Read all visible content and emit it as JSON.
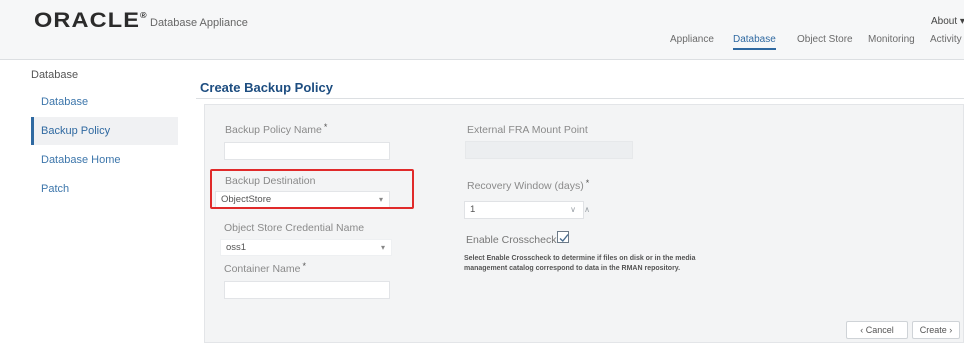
{
  "header": {
    "logo": "ORACLE",
    "product": "Database Appliance",
    "about": "About",
    "tabs": [
      {
        "label": "Appliance",
        "active": false
      },
      {
        "label": "Database",
        "active": true
      },
      {
        "label": "Object Store",
        "active": false
      },
      {
        "label": "Monitoring",
        "active": false
      },
      {
        "label": "Activity",
        "active": false
      }
    ]
  },
  "sidebar": {
    "title": "Database",
    "items": [
      {
        "label": "Database",
        "active": false
      },
      {
        "label": "Backup Policy",
        "active": true
      },
      {
        "label": "Database Home",
        "active": false
      },
      {
        "label": "Patch",
        "active": false
      }
    ]
  },
  "main": {
    "title": "Create Backup Policy",
    "form": {
      "backup_policy_name": {
        "label": "Backup Policy Name",
        "value": ""
      },
      "external_fra": {
        "label": "External FRA Mount Point",
        "value": ""
      },
      "backup_destination": {
        "label": "Backup Destination",
        "value": "ObjectStore"
      },
      "recovery_window": {
        "label": "Recovery Window (days)",
        "value": "1"
      },
      "credential": {
        "label": "Object Store Credential Name",
        "value": "oss1"
      },
      "crosscheck": {
        "label": "Enable Crosscheck",
        "checked": true,
        "help": "Select Enable Crosscheck to determine if files on disk or in the media management catalog correspond to data in the RMAN repository."
      },
      "container": {
        "label": "Container Name",
        "value": ""
      }
    },
    "buttons": {
      "cancel": "Cancel",
      "create": "Create"
    }
  },
  "colors": {
    "accent": "#2f69a1",
    "highlight": "#e02a2a",
    "panel": "#f3f4f5"
  }
}
